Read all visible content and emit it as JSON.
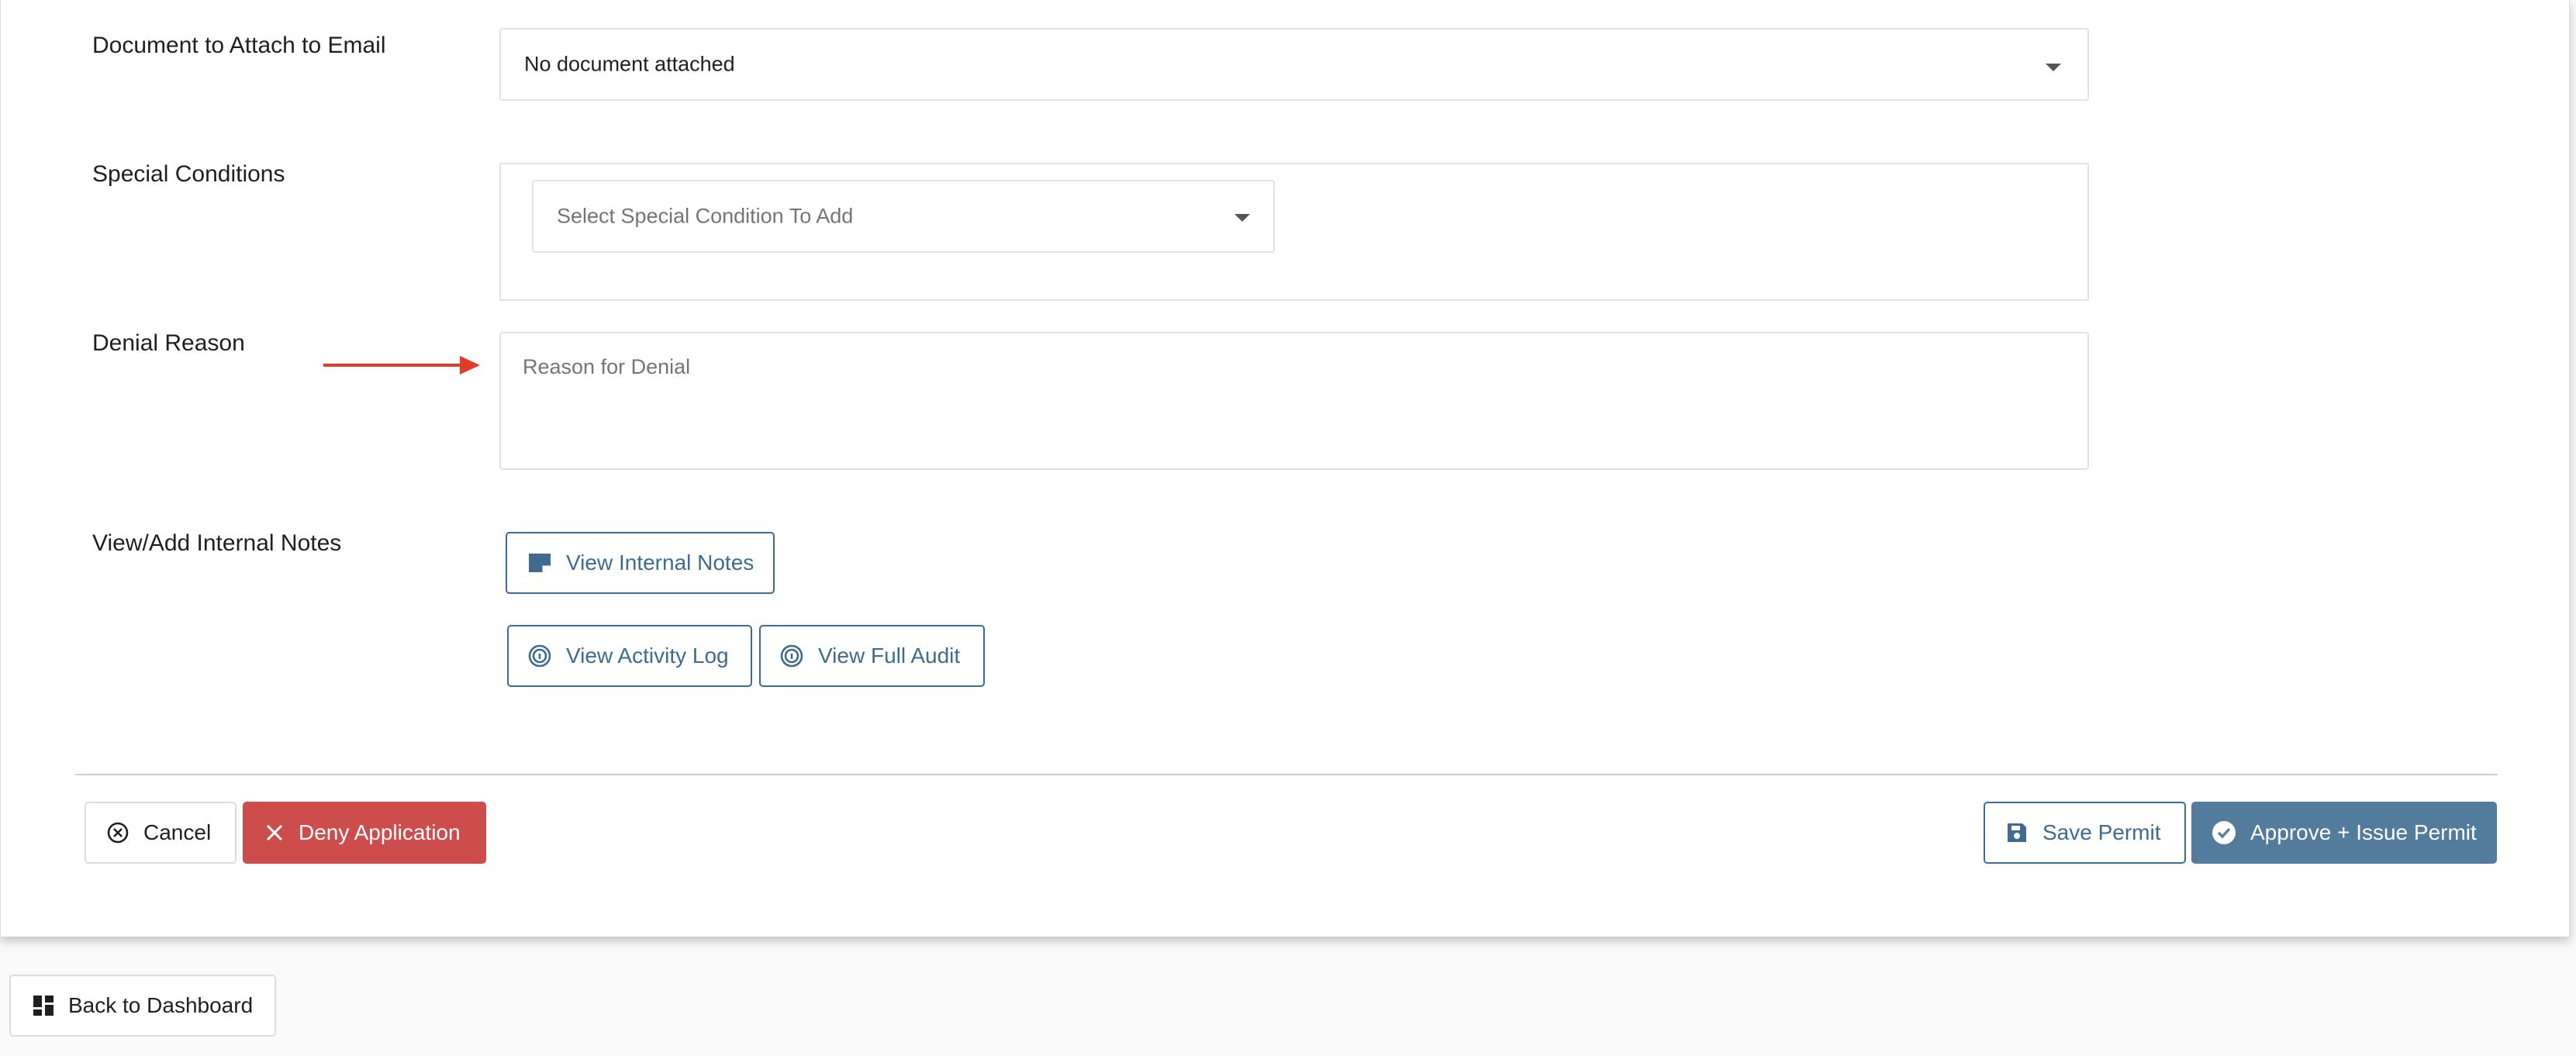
{
  "form": {
    "document_attach": {
      "label": "Document to Attach to Email",
      "selected": "No document attached"
    },
    "special_conditions": {
      "label": "Special Conditions",
      "placeholder": "Select Special Condition To Add"
    },
    "denial_reason": {
      "label": "Denial Reason",
      "placeholder": "Reason for Denial"
    },
    "internal_notes": {
      "label": "View/Add Internal Notes",
      "view_notes_button": "View Internal Notes",
      "activity_log_button": "View Activity Log",
      "full_audit_button": "View Full Audit"
    }
  },
  "actions": {
    "cancel": "Cancel",
    "deny": "Deny Application",
    "save": "Save Permit",
    "approve": "Approve + Issue Permit"
  },
  "footer": {
    "back_to_dashboard": "Back to Dashboard"
  },
  "colors": {
    "primary": "#527b9c",
    "outline_text": "#3e6b8f",
    "danger": "#cd4d4d",
    "arrow": "#e23b2a"
  }
}
